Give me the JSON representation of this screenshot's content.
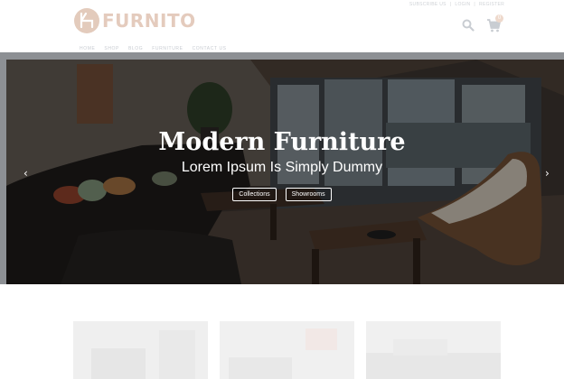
{
  "header": {
    "logo_text": "FURNITO",
    "top_links": [
      "SUBSCRIBE US",
      "|",
      "LOGIN",
      "|",
      "REGISTER"
    ],
    "cart_count": "0"
  },
  "nav": {
    "items": [
      "HOME",
      "SHOP",
      "BLOG",
      "FURNITURE",
      "CONTACT US"
    ]
  },
  "hero": {
    "title": "Modern Furniture",
    "subtitle": "Lorem Ipsum Is Simply Dummy",
    "buttons": [
      "Collections",
      "Showrooms"
    ],
    "prev_arrow": "‹",
    "next_arrow": "›"
  },
  "icons": {
    "search": "search-icon",
    "cart": "cart-icon",
    "logo": "chair-logo-icon"
  },
  "colors": {
    "logo": "#e4cbbd",
    "frame": "#8d9094"
  }
}
